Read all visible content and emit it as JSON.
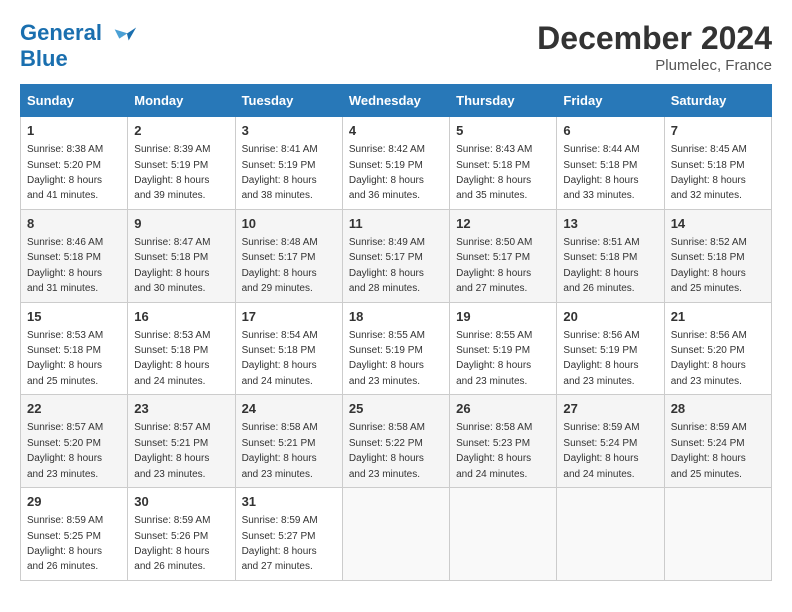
{
  "header": {
    "logo_line1": "General",
    "logo_line2": "Blue",
    "month": "December 2024",
    "location": "Plumelec, France"
  },
  "days_of_week": [
    "Sunday",
    "Monday",
    "Tuesday",
    "Wednesday",
    "Thursday",
    "Friday",
    "Saturday"
  ],
  "weeks": [
    [
      {
        "day": "1",
        "sunrise": "8:38 AM",
        "sunset": "5:20 PM",
        "daylight": "8 hours and 41 minutes."
      },
      {
        "day": "2",
        "sunrise": "8:39 AM",
        "sunset": "5:19 PM",
        "daylight": "8 hours and 39 minutes."
      },
      {
        "day": "3",
        "sunrise": "8:41 AM",
        "sunset": "5:19 PM",
        "daylight": "8 hours and 38 minutes."
      },
      {
        "day": "4",
        "sunrise": "8:42 AM",
        "sunset": "5:19 PM",
        "daylight": "8 hours and 36 minutes."
      },
      {
        "day": "5",
        "sunrise": "8:43 AM",
        "sunset": "5:18 PM",
        "daylight": "8 hours and 35 minutes."
      },
      {
        "day": "6",
        "sunrise": "8:44 AM",
        "sunset": "5:18 PM",
        "daylight": "8 hours and 33 minutes."
      },
      {
        "day": "7",
        "sunrise": "8:45 AM",
        "sunset": "5:18 PM",
        "daylight": "8 hours and 32 minutes."
      }
    ],
    [
      {
        "day": "8",
        "sunrise": "8:46 AM",
        "sunset": "5:18 PM",
        "daylight": "8 hours and 31 minutes."
      },
      {
        "day": "9",
        "sunrise": "8:47 AM",
        "sunset": "5:18 PM",
        "daylight": "8 hours and 30 minutes."
      },
      {
        "day": "10",
        "sunrise": "8:48 AM",
        "sunset": "5:17 PM",
        "daylight": "8 hours and 29 minutes."
      },
      {
        "day": "11",
        "sunrise": "8:49 AM",
        "sunset": "5:17 PM",
        "daylight": "8 hours and 28 minutes."
      },
      {
        "day": "12",
        "sunrise": "8:50 AM",
        "sunset": "5:17 PM",
        "daylight": "8 hours and 27 minutes."
      },
      {
        "day": "13",
        "sunrise": "8:51 AM",
        "sunset": "5:18 PM",
        "daylight": "8 hours and 26 minutes."
      },
      {
        "day": "14",
        "sunrise": "8:52 AM",
        "sunset": "5:18 PM",
        "daylight": "8 hours and 25 minutes."
      }
    ],
    [
      {
        "day": "15",
        "sunrise": "8:53 AM",
        "sunset": "5:18 PM",
        "daylight": "8 hours and 25 minutes."
      },
      {
        "day": "16",
        "sunrise": "8:53 AM",
        "sunset": "5:18 PM",
        "daylight": "8 hours and 24 minutes."
      },
      {
        "day": "17",
        "sunrise": "8:54 AM",
        "sunset": "5:18 PM",
        "daylight": "8 hours and 24 minutes."
      },
      {
        "day": "18",
        "sunrise": "8:55 AM",
        "sunset": "5:19 PM",
        "daylight": "8 hours and 23 minutes."
      },
      {
        "day": "19",
        "sunrise": "8:55 AM",
        "sunset": "5:19 PM",
        "daylight": "8 hours and 23 minutes."
      },
      {
        "day": "20",
        "sunrise": "8:56 AM",
        "sunset": "5:19 PM",
        "daylight": "8 hours and 23 minutes."
      },
      {
        "day": "21",
        "sunrise": "8:56 AM",
        "sunset": "5:20 PM",
        "daylight": "8 hours and 23 minutes."
      }
    ],
    [
      {
        "day": "22",
        "sunrise": "8:57 AM",
        "sunset": "5:20 PM",
        "daylight": "8 hours and 23 minutes."
      },
      {
        "day": "23",
        "sunrise": "8:57 AM",
        "sunset": "5:21 PM",
        "daylight": "8 hours and 23 minutes."
      },
      {
        "day": "24",
        "sunrise": "8:58 AM",
        "sunset": "5:21 PM",
        "daylight": "8 hours and 23 minutes."
      },
      {
        "day": "25",
        "sunrise": "8:58 AM",
        "sunset": "5:22 PM",
        "daylight": "8 hours and 23 minutes."
      },
      {
        "day": "26",
        "sunrise": "8:58 AM",
        "sunset": "5:23 PM",
        "daylight": "8 hours and 24 minutes."
      },
      {
        "day": "27",
        "sunrise": "8:59 AM",
        "sunset": "5:24 PM",
        "daylight": "8 hours and 24 minutes."
      },
      {
        "day": "28",
        "sunrise": "8:59 AM",
        "sunset": "5:24 PM",
        "daylight": "8 hours and 25 minutes."
      }
    ],
    [
      {
        "day": "29",
        "sunrise": "8:59 AM",
        "sunset": "5:25 PM",
        "daylight": "8 hours and 26 minutes."
      },
      {
        "day": "30",
        "sunrise": "8:59 AM",
        "sunset": "5:26 PM",
        "daylight": "8 hours and 26 minutes."
      },
      {
        "day": "31",
        "sunrise": "8:59 AM",
        "sunset": "5:27 PM",
        "daylight": "8 hours and 27 minutes."
      },
      null,
      null,
      null,
      null
    ]
  ]
}
